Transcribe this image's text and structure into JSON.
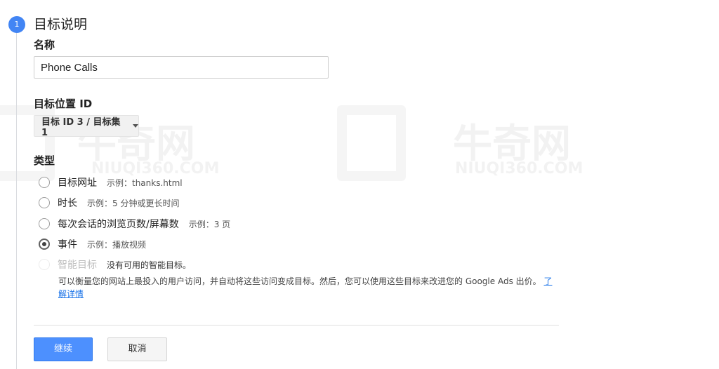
{
  "step": {
    "number": "1",
    "title": "目标说明"
  },
  "name_field": {
    "label": "名称",
    "value": "Phone Calls"
  },
  "goal_slot": {
    "label": "目标位置 ID",
    "selected": "目标 ID 3 / 目标集 1"
  },
  "type": {
    "label": "类型",
    "options": [
      {
        "label": "目标网址",
        "example": "示例：thanks.html"
      },
      {
        "label": "时长",
        "example": "示例：5 分钟或更长时间"
      },
      {
        "label": "每次会话的浏览页数/屏幕数",
        "example": "示例：3 页"
      },
      {
        "label": "事件",
        "example": "示例：播放视频"
      },
      {
        "label": "智能目标",
        "example": "没有可用的智能目标。"
      }
    ],
    "smart_description": "可以衡量您的网站上最投入的用户访问，并自动将这些访问变成目标。然后，您可以使用这些目标来改进您的 Google Ads 出价。",
    "learn_more": "了解详情"
  },
  "buttons": {
    "continue": "继续",
    "cancel": "取消"
  },
  "watermark": {
    "brand": "牛奇网",
    "domain": "NIUQI360.COM"
  }
}
